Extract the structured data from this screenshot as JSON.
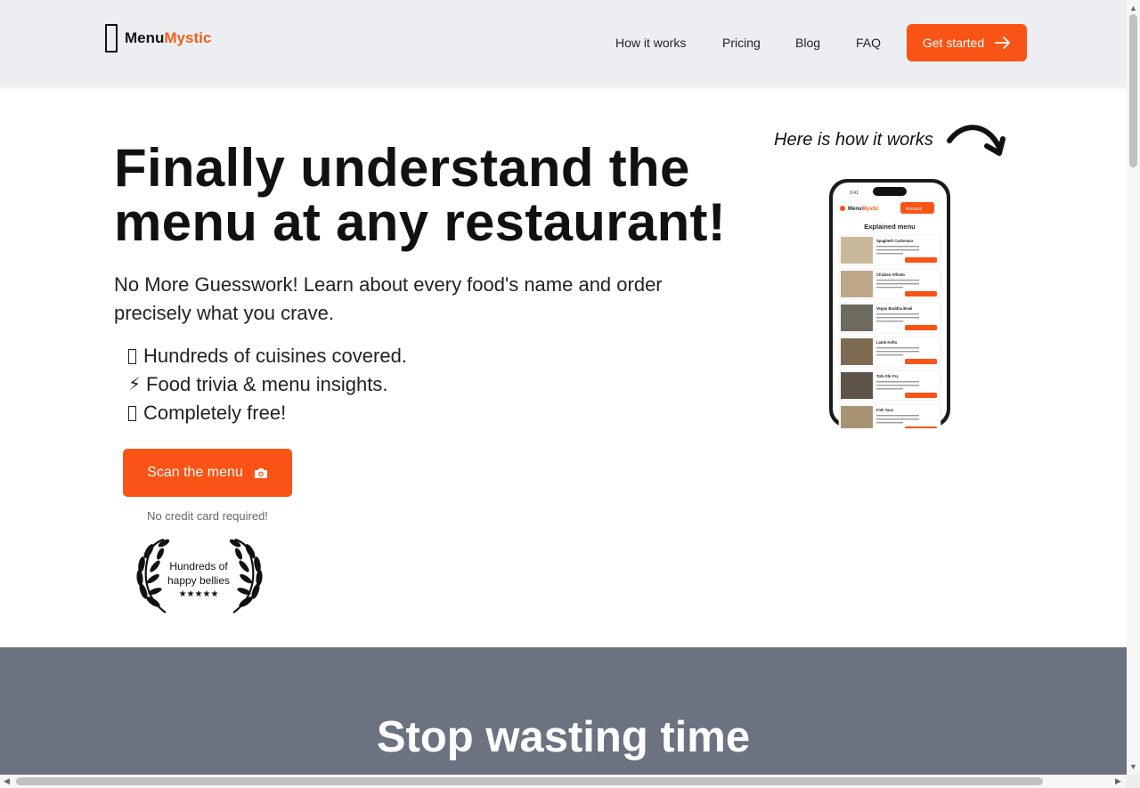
{
  "header": {
    "logo_icon": "app-logo-icon",
    "brand_part1": "Menu",
    "brand_part2": "Mystic",
    "nav": {
      "how_it_works": "How it works",
      "pricing": "Pricing",
      "blog": "Blog",
      "faq": "FAQ"
    },
    "cta_label": "Get started",
    "cta_icon": "arrow-right-icon"
  },
  "hero": {
    "title": "Finally understand the menu at any restaurant!",
    "subtitle": "No More Guesswork! Learn about every food's name and order precisely what you crave.",
    "features": [
      {
        "icon": "missing-glyph-icon",
        "text": "Hundreds of cuisines covered."
      },
      {
        "icon": "lightning-icon",
        "glyph": "⚡",
        "text": "Food trivia & menu insights."
      },
      {
        "icon": "missing-glyph-icon",
        "text": "Completely free!"
      }
    ],
    "scan_button_label": "Scan the menu",
    "scan_button_icon": "camera-icon",
    "no_credit_card": "No credit card required!",
    "badge": {
      "line1": "Hundreds of",
      "line2": "happy bellies",
      "stars": "★★★★★"
    },
    "how_it_works_label": "Here is how it works"
  },
  "phone_preview": {
    "time": "9:41",
    "brand_part1": "Menu",
    "brand_part2": "Mystic",
    "button_label": "Account",
    "heading": "Explained menu",
    "items": [
      {
        "name": "Spaghetti Carbonara"
      },
      {
        "name": "Chicken Alfredo"
      },
      {
        "name": "Vegan Buddha Bowl"
      },
      {
        "name": "Lamb Kofta"
      },
      {
        "name": "Tofu Stir Fry"
      },
      {
        "name": "Fish Taco"
      }
    ]
  },
  "section2": {
    "title": "Stop wasting time"
  },
  "colors": {
    "accent": "#fa5316",
    "header_bg": "#eceef1",
    "section2_bg": "#6b7280"
  }
}
